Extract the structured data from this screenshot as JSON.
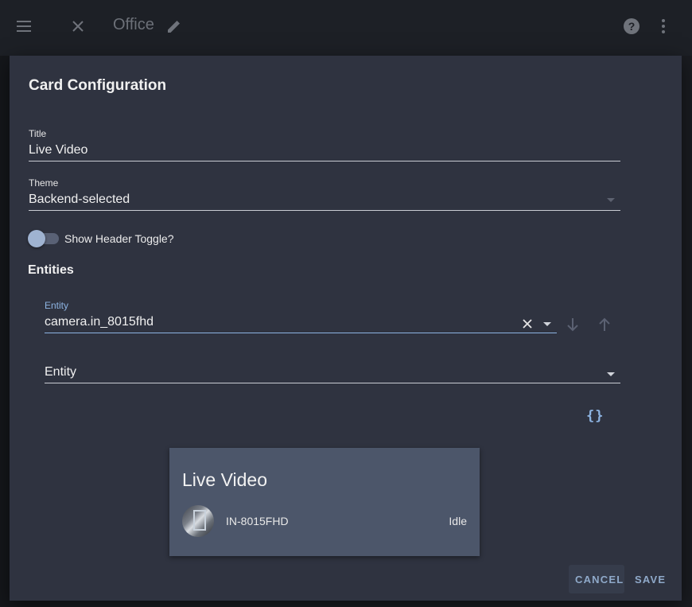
{
  "background": {
    "title": "Office",
    "icons": [
      "menu-icon",
      "close-icon",
      "pencil-icon",
      "help-icon",
      "more-vert-icon"
    ]
  },
  "dialog": {
    "title": "Card Configuration",
    "title_field": {
      "label": "Title",
      "value": "Live Video"
    },
    "theme_field": {
      "label": "Theme",
      "value": "Backend-selected"
    },
    "toggle": {
      "label": "Show Header Toggle?",
      "on": false
    },
    "entities_heading": "Entities",
    "entity_rows": [
      {
        "label": "Entity",
        "value": "camera.in_8015fhd"
      },
      {
        "label": "",
        "placeholder": "Entity"
      }
    ],
    "code_editor_icon": "{}",
    "preview": {
      "title": "Live Video",
      "entity_name": "IN-8015FHD",
      "entity_state": "Idle"
    },
    "buttons": {
      "cancel": "CANCEL",
      "save": "SAVE"
    }
  },
  "colors": {
    "dialog_bg": "#2f3340",
    "card_bg": "#4c566a",
    "accent": "#8db4e2",
    "page_bg": "#1a1c21"
  }
}
